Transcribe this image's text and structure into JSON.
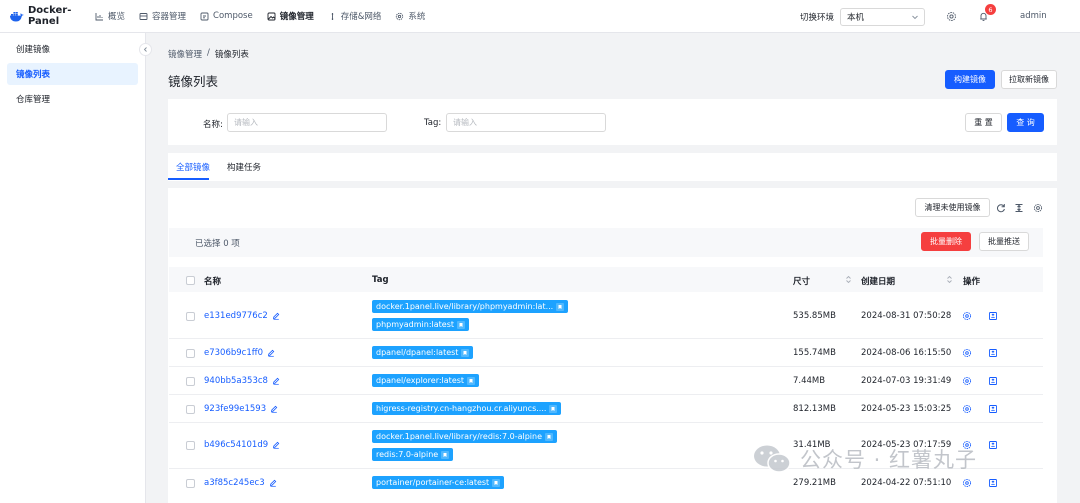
{
  "app": {
    "title": "Docker-Panel"
  },
  "nav": [
    {
      "label": "概览",
      "icon": "chart-icon"
    },
    {
      "label": "容器管理",
      "icon": "container-icon"
    },
    {
      "label": "Compose",
      "icon": "compose-icon"
    },
    {
      "label": "镜像管理",
      "icon": "image-icon",
      "active": true
    },
    {
      "label": "存储&网络",
      "icon": "storage-icon"
    },
    {
      "label": "系统",
      "icon": "gear-icon"
    }
  ],
  "header": {
    "env_label": "切换环境",
    "env_value": "本机",
    "notification_count": "6",
    "user": "admin"
  },
  "sidebar": {
    "items": [
      {
        "label": "创建镜像"
      },
      {
        "label": "镜像列表",
        "active": true
      },
      {
        "label": "仓库管理"
      }
    ]
  },
  "breadcrumb": {
    "parent": "镜像管理",
    "separator": "/",
    "current": "镜像列表"
  },
  "page": {
    "title": "镜像列表",
    "build_button": "构建镜像",
    "pull_button": "拉取新镜像"
  },
  "search": {
    "name_label": "名称:",
    "name_placeholder": "请输入",
    "tag_label": "Tag:",
    "tag_placeholder": "请输入",
    "reset_button": "重 置",
    "query_button": "查 询"
  },
  "tabs": [
    {
      "label": "全部镜像",
      "active": true
    },
    {
      "label": "构建任务"
    }
  ],
  "toolbar": {
    "clean_button": "清理未使用镜像",
    "selected_text": "已选择  0  项",
    "batch_delete_button": "批量删除",
    "batch_push_button": "批量推送"
  },
  "table": {
    "columns": [
      "名称",
      "Tag",
      "尺寸",
      "创建日期",
      "操作"
    ],
    "rows": [
      {
        "name": "e131ed9776c2",
        "tags": [
          "docker.1panel.live/library/phpmyadmin:lat...",
          "phpmyadmin:latest"
        ],
        "size": "535.85MB",
        "created": "2024-08-31 07:50:28"
      },
      {
        "name": "e7306b9c1ff0",
        "tags": [
          "dpanel/dpanel:latest"
        ],
        "size": "155.74MB",
        "created": "2024-08-06 16:15:50"
      },
      {
        "name": "940bb5a353c8",
        "tags": [
          "dpanel/explorer:latest"
        ],
        "size": "7.44MB",
        "created": "2024-07-03 19:31:49"
      },
      {
        "name": "923fe99e1593",
        "tags": [
          "higress-registry.cn-hangzhou.cr.aliyuncs...."
        ],
        "size": "812.13MB",
        "created": "2024-05-23 15:03:25"
      },
      {
        "name": "b496c54101d9",
        "tags": [
          "docker.1panel.live/library/redis:7.0-alpine",
          "redis:7.0-alpine"
        ],
        "size": "31.41MB",
        "created": "2024-05-23 07:17:59"
      },
      {
        "name": "a3f85c245ec3",
        "tags": [
          "portainer/portainer-ce:latest"
        ],
        "size": "279.21MB",
        "created": "2024-04-22 07:51:10"
      }
    ]
  },
  "watermark": {
    "text": "公众号 · 红薯丸子"
  },
  "colors": {
    "primary": "#165dff",
    "danger": "#f53f3f",
    "tag": "#1da2ff"
  }
}
